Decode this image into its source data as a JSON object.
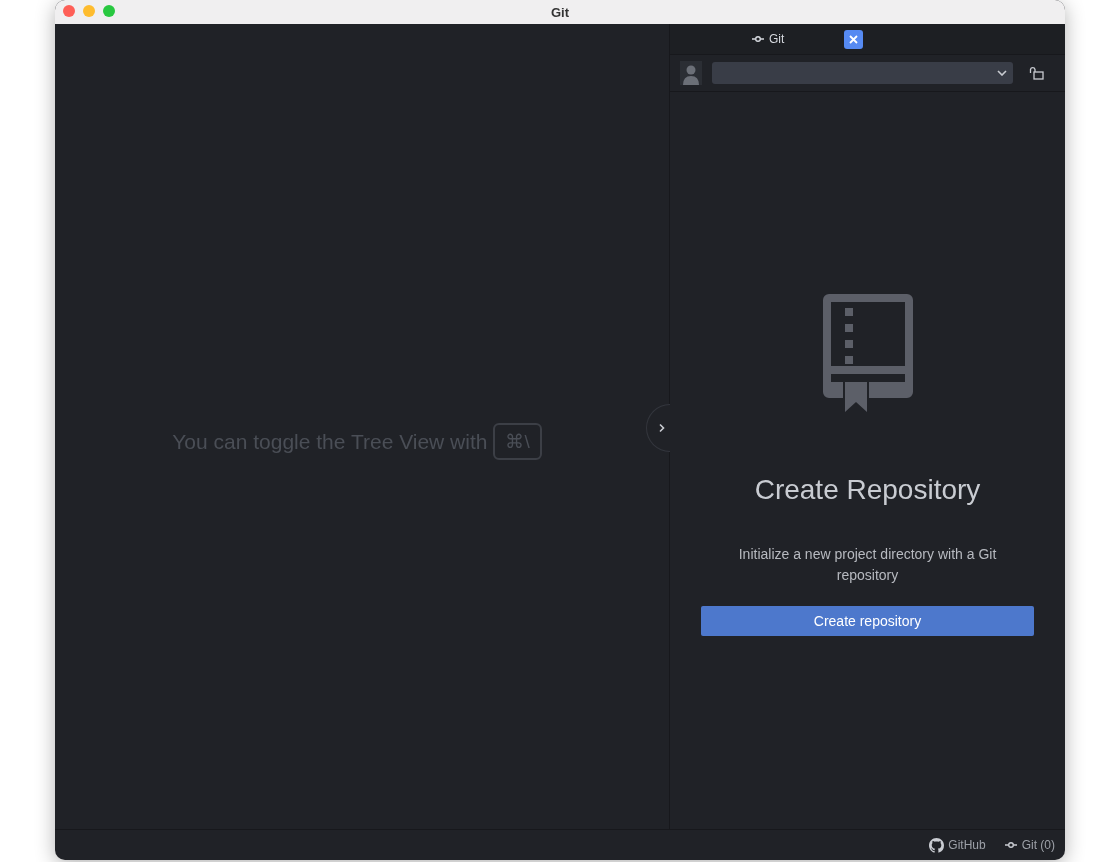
{
  "window": {
    "title": "Git"
  },
  "editor": {
    "hint": "You can toggle the Tree View with",
    "shortcut": "⌘\\"
  },
  "git_panel": {
    "tab": {
      "label": "Git"
    },
    "empty_state": {
      "title": "Create Repository",
      "description": "Initialize a new project directory with a Git repository",
      "button": "Create repository"
    }
  },
  "status_bar": [
    {
      "kind": "github",
      "label": "GitHub"
    },
    {
      "kind": "git",
      "label": "Git (0)"
    }
  ]
}
